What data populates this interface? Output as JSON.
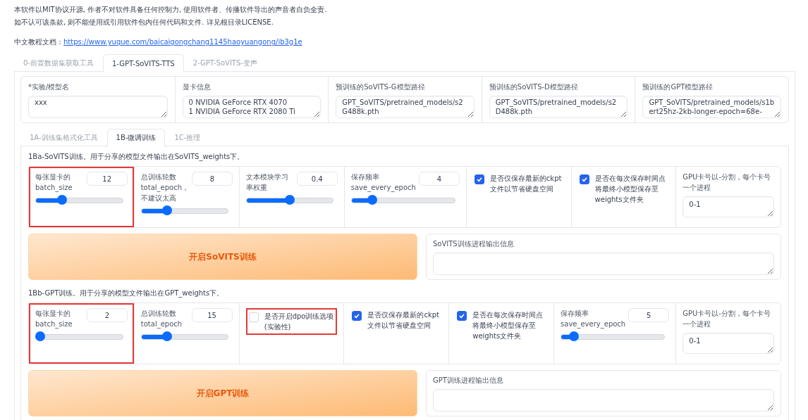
{
  "notice": [
    "本软件以MIT协议开源, 作者不对软件具备任何控制力, 使用软件者、传播软件导出的声音者自负全责.",
    "如不认可该条款, 则不能使用或引用软件包内任何代码和文件. 详见根目录LICENSE."
  ],
  "doc_link": {
    "label": "中文教程文档：",
    "url": "https://www.yuque.com/baicaigongchang1145haoyuangong/ib3g1e"
  },
  "tabs": [
    {
      "label": "0-前置数据集获取工具",
      "selected": false
    },
    {
      "label": "1-GPT-SoVITS-TTS",
      "selected": true
    },
    {
      "label": "2-GPT-SoVITS-变声",
      "selected": false
    }
  ],
  "model_fields": [
    {
      "label": "*实验/模型名",
      "value": "xxx"
    },
    {
      "label": "显卡信息",
      "value": "0 NVIDIA GeForce RTX 4070\n1 NVIDIA GeForce RTX 2080 Ti"
    },
    {
      "label": "预训练的SoVITS-G模型路径",
      "value": "GPT_SoVITS/pretrained_models/s2G488k.pth"
    },
    {
      "label": "预训练的SoVITS-D模型路径",
      "value": "GPT_SoVITS/pretrained_models/s2D488k.pth"
    },
    {
      "label": "预训练的GPT模型路径",
      "value": "GPT_SoVITS/pretrained_models/s1bert25hz-2kb-longer-epoch=68e-"
    }
  ],
  "sub_tabs": [
    {
      "label": "1A-训练集格式化工具",
      "selected": false
    },
    {
      "label": "1B-微调训练",
      "selected": true
    },
    {
      "label": "1C-推理",
      "selected": false
    }
  ],
  "sections": [
    {
      "title": "1Ba-SoVITS训练。用于分享的模型文件输出在SoVITS_weights下。",
      "button": "开启SoVITS训练",
      "output_label": "SoVITS训练进程输出信息",
      "controls": [
        {
          "kind": "slider",
          "label": "每张显卡的batch_size",
          "value": "12",
          "level": 0.3,
          "highlighted": true
        },
        {
          "kind": "slider",
          "label": "总训练轮数total_epoch，不建议太高",
          "value": "8",
          "level": 0.3,
          "highlighted": false
        },
        {
          "kind": "slider",
          "label": "文本模块学习率权重",
          "value": "0.4",
          "level": 0.5,
          "highlighted": false
        },
        {
          "kind": "slider",
          "label": "保存频率save_every_epoch",
          "value": "4",
          "level": 0.2,
          "highlighted": false
        },
        {
          "kind": "checkbox",
          "label": "是否仅保存最新的ckpt文件以节省硬盘空间",
          "checked": true,
          "highlighted": false
        },
        {
          "kind": "checkbox",
          "label": "是否在每次保存时间点将最终小模型保存至weights文件夹",
          "checked": true,
          "highlighted": false
        },
        {
          "kind": "textfield",
          "label": "GPU卡号以-分割，每个卡号一个进程",
          "value": "0-1",
          "highlighted": false
        }
      ]
    },
    {
      "title": "1Bb-GPT训练。用于分享的模型文件输出在GPT_weights下。",
      "button": "开启GPT训练",
      "output_label": "GPT训练进程输出信息",
      "controls": [
        {
          "kind": "slider",
          "label": "每张显卡的batch_size",
          "value": "2",
          "level": 0.05,
          "highlighted": true
        },
        {
          "kind": "slider",
          "label": "总训练轮数total_epoch",
          "value": "15",
          "level": 0.3,
          "highlighted": false
        },
        {
          "kind": "checkbox",
          "label": "是否开启dpo训练选项(实验性)",
          "checked": false,
          "highlighted": true
        },
        {
          "kind": "checkbox",
          "label": "是否仅保存最新的ckpt文件以节省硬盘空间",
          "checked": true,
          "highlighted": false
        },
        {
          "kind": "checkbox",
          "label": "是否在每次保存时间点将最终小模型保存至weights文件夹",
          "checked": true,
          "highlighted": false
        },
        {
          "kind": "slider",
          "label": "保存频率save_every_epoch",
          "value": "5",
          "level": 0.12,
          "highlighted": false
        },
        {
          "kind": "textfield",
          "label": "GPU卡号以-分割，每个卡号一个进程",
          "value": "0-1",
          "highlighted": false
        }
      ]
    }
  ]
}
